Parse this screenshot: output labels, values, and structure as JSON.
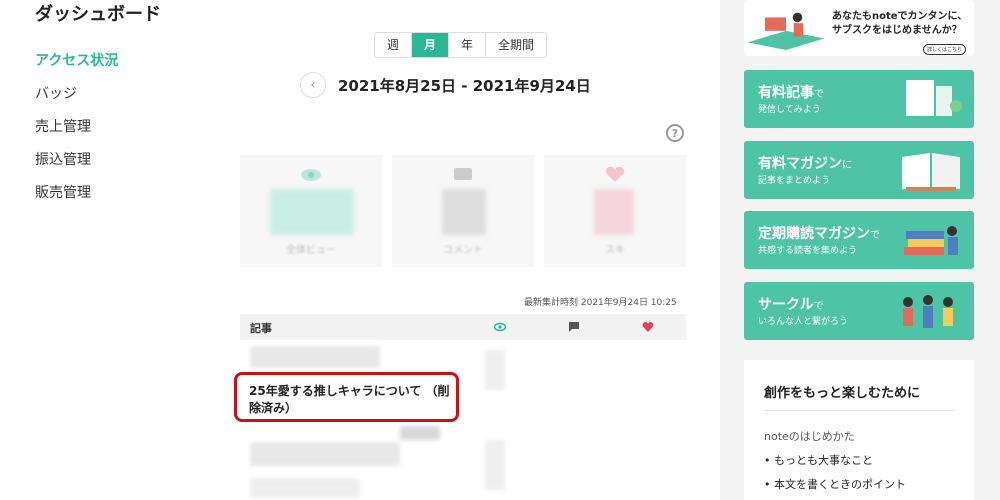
{
  "sidebar": {
    "title": "ダッシュボード",
    "items": [
      {
        "label": "アクセス状況",
        "active": true
      },
      {
        "label": "バッジ",
        "active": false
      },
      {
        "label": "売上管理",
        "active": false
      },
      {
        "label": "振込管理",
        "active": false
      },
      {
        "label": "販売管理",
        "active": false
      }
    ]
  },
  "period_tabs": {
    "week": "週",
    "month": "月",
    "year": "年",
    "all": "全期間",
    "selected": "月"
  },
  "date_range": {
    "prev_icon": "chevron-left-icon",
    "text": "2021年8月25日 - 2021年9月24日"
  },
  "help_icon": "?",
  "stats": {
    "views_label": "全体ビュー",
    "comments_label": "コメント",
    "likes_label": "スキ"
  },
  "updated_text": "最新集計時刻 2021年9月24日 10:25",
  "table": {
    "header_label": "記事",
    "icons": [
      "eye-icon",
      "comment-icon",
      "heart-icon"
    ],
    "highlighted_article": "25年愛する推しキャラについて （削除済み）"
  },
  "banners": {
    "top": {
      "text": "あなたもnoteでカンタンに、サブスクをはじめませんか？",
      "button": "詳しくはこちら"
    },
    "items": [
      {
        "title": "有料記事",
        "title_suffix": "で",
        "sub": "発信してみよう"
      },
      {
        "title": "有料マガジン",
        "title_suffix": "に",
        "sub": "記事をまとめよう"
      },
      {
        "title": "定期購読マガジン",
        "title_suffix": "で",
        "sub": "共感する読者を集めよう"
      },
      {
        "title": "サークル",
        "title_suffix": "で",
        "sub": "いろんな人と繋がろう"
      }
    ]
  },
  "side_box": {
    "title": "創作をもっと楽しむために",
    "link": "noteのはじめかた",
    "bullets": [
      "もっとも大事なこと",
      "本文を書くときのポイント"
    ]
  },
  "colors": {
    "accent": "#2cb696",
    "highlight": "#c8101a",
    "banner": "#4ec3a6"
  }
}
